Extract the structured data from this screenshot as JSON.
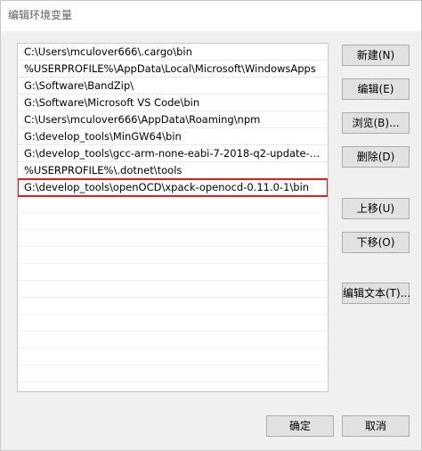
{
  "window": {
    "title": "编辑环境变量"
  },
  "path_list": {
    "items": [
      "C:\\Users\\mculover666\\.cargo\\bin",
      "%USERPROFILE%\\AppData\\Local\\Microsoft\\WindowsApps",
      "G:\\Software\\BandZip\\",
      "G:\\Software\\Microsoft VS Code\\bin",
      "C:\\Users\\mculover666\\AppData\\Roaming\\npm",
      "G:\\develop_tools\\MinGW64\\bin",
      "G:\\develop_tools\\gcc-arm-none-eabi-7-2018-q2-update-win32\\...",
      "%USERPROFILE%\\.dotnet\\tools",
      "G:\\develop_tools\\openOCD\\xpack-openocd-0.11.0-1\\bin"
    ],
    "selected_index": 8
  },
  "buttons": {
    "new": "新建(N)",
    "edit": "编辑(E)",
    "browse": "浏览(B)...",
    "delete": "删除(D)",
    "move_up": "上移(U)",
    "move_down": "下移(O)",
    "edit_text": "编辑文本(T)...",
    "ok": "确定",
    "cancel": "取消"
  },
  "colors": {
    "selection_highlight": "#e01e1e"
  }
}
